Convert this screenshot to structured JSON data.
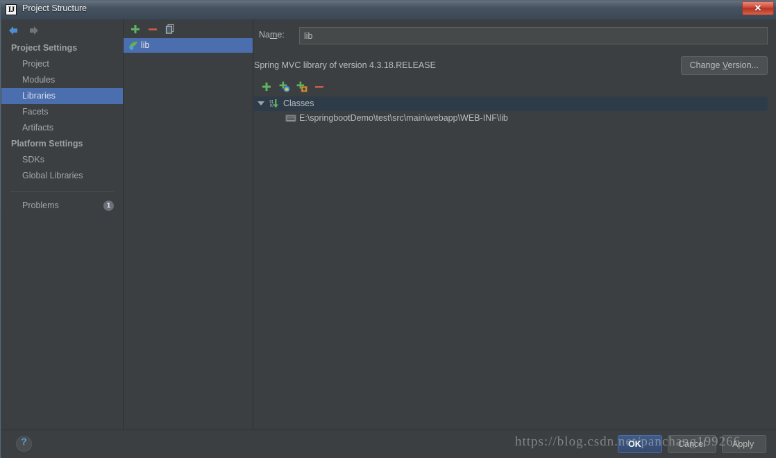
{
  "window": {
    "title": "Project Structure",
    "app_icon": "intellij-idea-icon",
    "app_icon_text": "IJ",
    "close_label": "✕"
  },
  "nav_toolbar": {
    "back_icon": "arrow-left-icon",
    "forward_icon": "arrow-right-icon"
  },
  "sidebar": {
    "groups": [
      {
        "label": "Project Settings",
        "items": [
          {
            "label": "Project",
            "selected": false
          },
          {
            "label": "Modules",
            "selected": false
          },
          {
            "label": "Libraries",
            "selected": true
          },
          {
            "label": "Facets",
            "selected": false
          },
          {
            "label": "Artifacts",
            "selected": false
          }
        ]
      },
      {
        "label": "Platform Settings",
        "items": [
          {
            "label": "SDKs",
            "selected": false
          },
          {
            "label": "Global Libraries",
            "selected": false
          }
        ]
      }
    ],
    "problems": {
      "label": "Problems",
      "count": "1"
    }
  },
  "libraries_panel": {
    "toolbar": [
      {
        "name": "add-library-button",
        "icon": "plus-icon"
      },
      {
        "name": "remove-library-button",
        "icon": "minus-icon"
      },
      {
        "name": "copy-library-button",
        "icon": "copy-icon"
      }
    ],
    "items": [
      {
        "label": "lib",
        "icon": "library-icon",
        "selected": true
      }
    ]
  },
  "detail": {
    "name_label_pre": "Na",
    "name_label_mnemonic": "m",
    "name_label_post": "e:",
    "name_value": "lib",
    "name_placeholder": "",
    "description": "Spring MVC library of version 4.3.18.RELEASE",
    "change_version_pre": "Change ",
    "change_version_mnemonic": "V",
    "change_version_post": "ersion...",
    "roots_toolbar": [
      {
        "name": "add-root-button",
        "icon": "plus-icon"
      },
      {
        "name": "add-classes-root-button",
        "icon": "plus-classes-icon"
      },
      {
        "name": "add-sources-root-button",
        "icon": "plus-sources-icon"
      },
      {
        "name": "remove-root-button",
        "icon": "minus-icon"
      }
    ],
    "tree": [
      {
        "label": "Classes",
        "icon": "classes-root-icon",
        "level": 1,
        "selected": true,
        "expanded": true
      },
      {
        "label": "E:\\springbootDemo\\test\\src\\main\\webapp\\WEB-INF\\lib",
        "icon": "jar-directory-icon",
        "level": 2,
        "selected": false,
        "expanded": false
      }
    ]
  },
  "footer": {
    "help_icon": "question-mark-icon",
    "help_label": "?",
    "ok_label": "OK",
    "cancel_label": "Cancel",
    "apply_label": "Apply"
  },
  "watermark": {
    "text": "https://blog.csdn.net/panchang199266"
  },
  "colors": {
    "panel_bg": "#3c3f41",
    "selection_blue": "#4b6eaf",
    "tree_selection": "#2e3c4a",
    "text": "#bbbbbb",
    "accent_green": "#4caf50",
    "accent_red": "#cc5a4a",
    "titlebar": "#46535f"
  }
}
